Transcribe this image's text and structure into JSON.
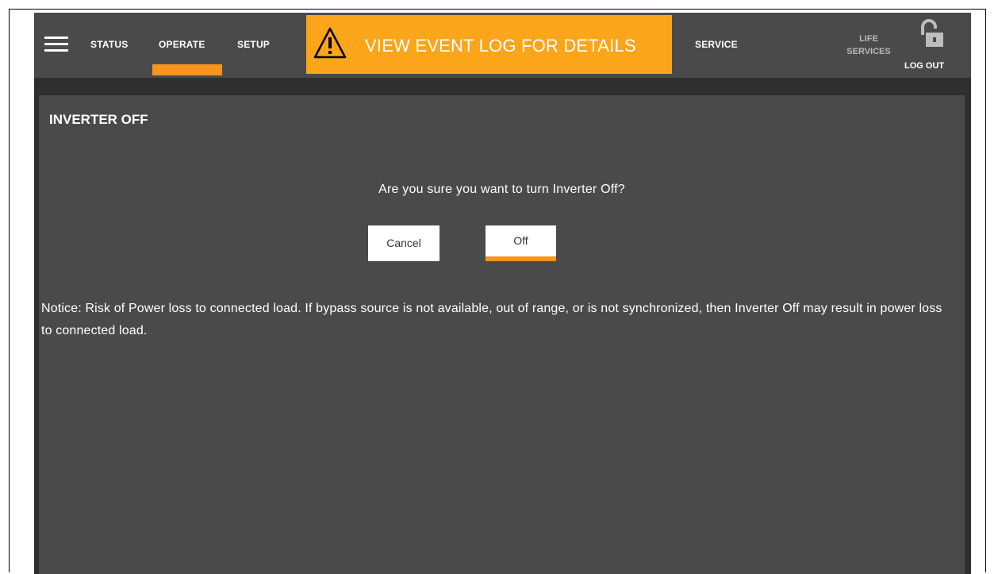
{
  "nav": {
    "status": "STATUS",
    "operate": "OPERATE",
    "setup": "SETUP",
    "service": "SERVICE",
    "life_services_line1": "LIFE",
    "life_services_line2": "SERVICES",
    "logout": "LOG OUT",
    "active": "OPERATE"
  },
  "alert": {
    "text": "VIEW EVENT LOG FOR DETAILS",
    "icon": "warning-triangle-icon",
    "color": "#faa51a"
  },
  "dialog": {
    "title": "INVERTER OFF",
    "question": "Are you sure you want to turn Inverter Off?",
    "cancel_label": "Cancel",
    "off_label": "Off",
    "notice": "Notice: Risk of Power loss to connected load. If bypass source is not available, out of range, or is not synchronized, then Inverter Off may result in power loss to connected load."
  },
  "colors": {
    "accent": "#f7941d",
    "panel": "#4a4a4a",
    "background": "#2f2f2f"
  }
}
